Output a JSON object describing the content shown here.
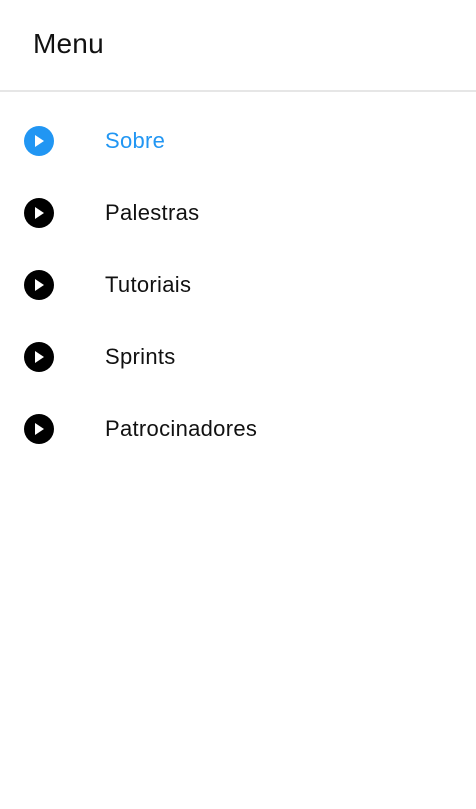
{
  "header": {
    "title": "Menu"
  },
  "colors": {
    "active": "#2196F3",
    "inactive": "#000000"
  },
  "menu": {
    "items": [
      {
        "label": "Sobre",
        "icon": "play-circle-icon",
        "active": true
      },
      {
        "label": "Palestras",
        "icon": "play-circle-icon",
        "active": false
      },
      {
        "label": "Tutoriais",
        "icon": "play-circle-icon",
        "active": false
      },
      {
        "label": "Sprints",
        "icon": "play-circle-icon",
        "active": false
      },
      {
        "label": "Patrocinadores",
        "icon": "play-circle-icon",
        "active": false
      }
    ]
  }
}
